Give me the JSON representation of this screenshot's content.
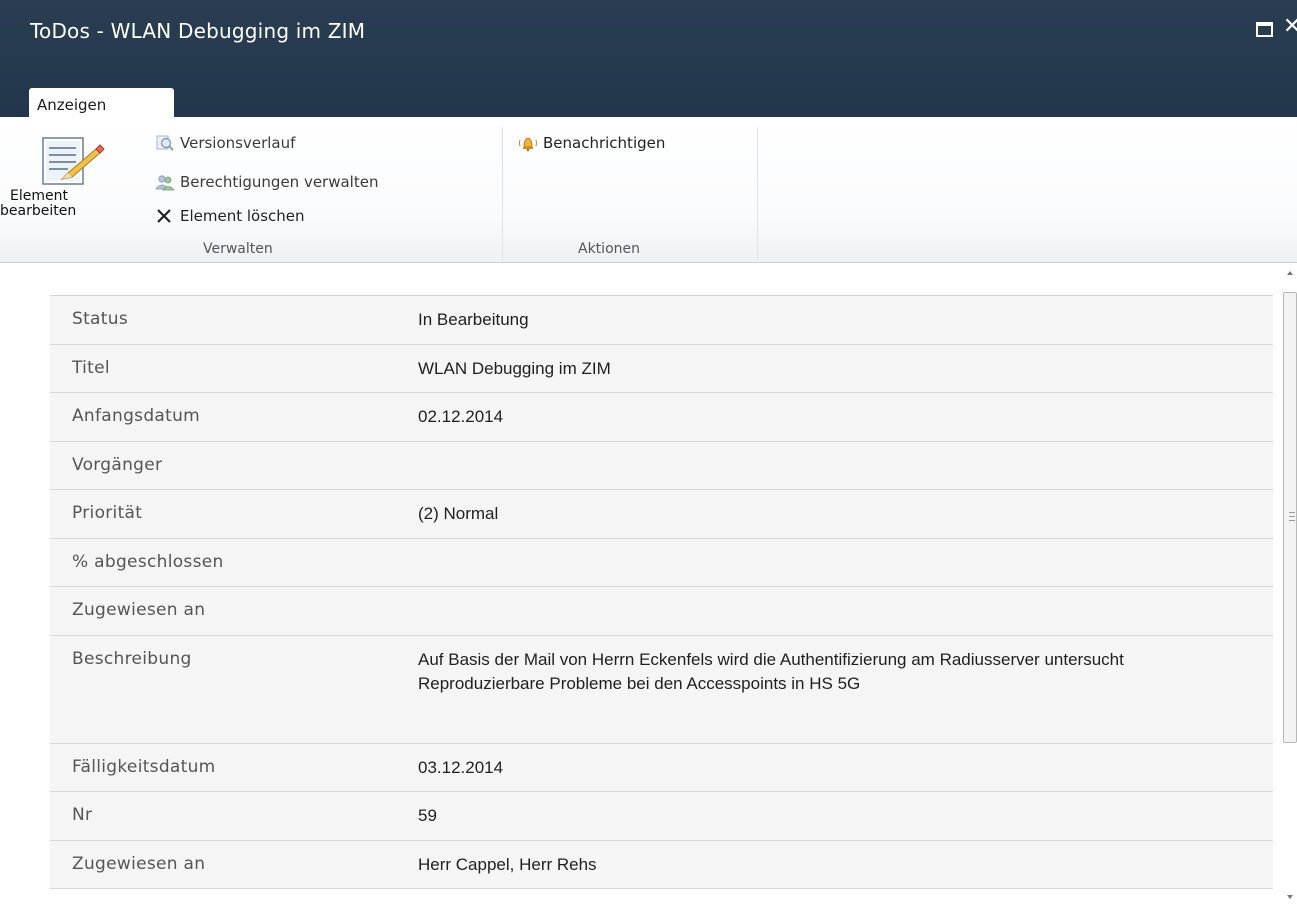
{
  "window": {
    "title": "ToDos - WLAN Debugging im ZIM"
  },
  "ribbon": {
    "tab": "Anzeigen",
    "groups": {
      "verwalten": {
        "label": "Verwalten",
        "edit_item": {
          "line1": "Element",
          "line2": "bearbeiten"
        },
        "version_history": "Versionsverlauf",
        "manage_permissions": "Berechtigungen verwalten",
        "delete_item": "Element löschen"
      },
      "aktionen": {
        "label": "Aktionen",
        "alert_me": "Benachrichtigen"
      }
    }
  },
  "properties": [
    {
      "label": "Status",
      "value": "In Bearbeitung"
    },
    {
      "label": "Titel",
      "value": "WLAN Debugging im ZIM"
    },
    {
      "label": "Anfangsdatum",
      "value": "02.12.2014"
    },
    {
      "label": "Vorgänger",
      "value": ""
    },
    {
      "label": "Priorität",
      "value": "(2) Normal"
    },
    {
      "label": "% abgeschlossen",
      "value": ""
    },
    {
      "label": "Zugewiesen an",
      "value": ""
    },
    {
      "label": "Beschreibung",
      "value": "Auf Basis der Mail von Herrn Eckenfels wird die Authentifizierung am Radiusserver untersucht Reproduzierbare Probleme bei den Accesspoints in HS 5G"
    },
    {
      "label": "Fälligkeitsdatum",
      "value": "03.12.2014"
    },
    {
      "label": "Nr",
      "value": "59"
    },
    {
      "label": "Zugewiesen an",
      "value": "Herr Cappel, Herr Rehs"
    }
  ],
  "colors": {
    "titlebar": "#263a4e",
    "row_background": "#f5f5f5",
    "label_text": "#555555"
  },
  "icons": {
    "edit": "pencil-document-icon",
    "history": "magnifier-icon",
    "permissions": "people-icon",
    "delete": "x-icon",
    "alert": "bell-icon",
    "maximize": "maximize-icon",
    "close": "close-icon"
  }
}
